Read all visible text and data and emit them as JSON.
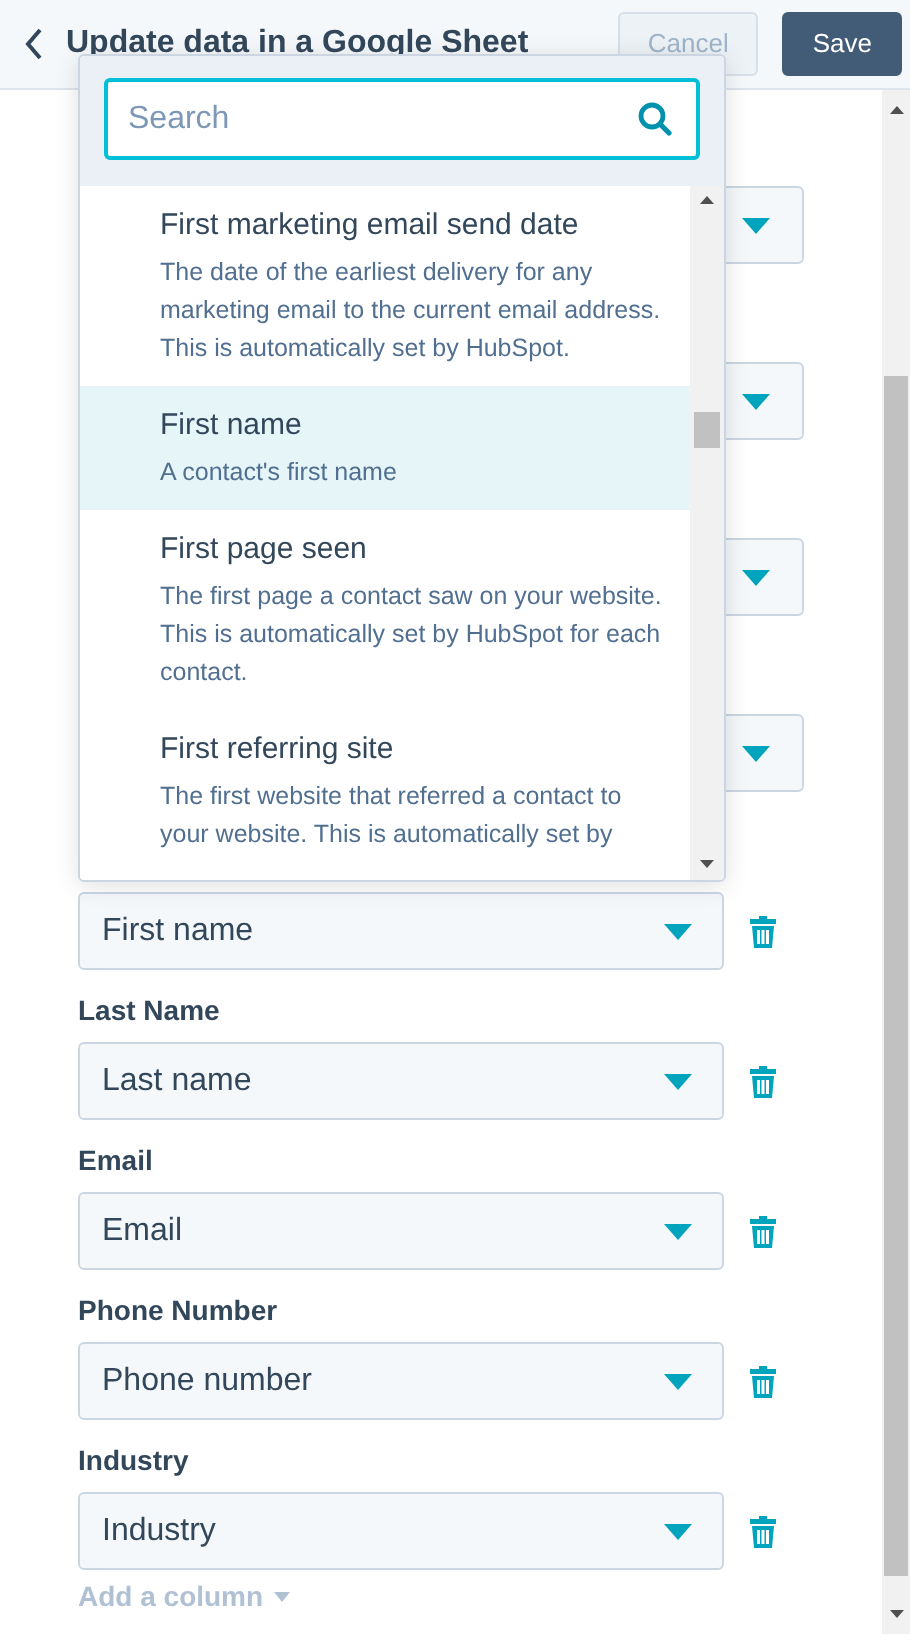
{
  "header": {
    "title": "Update data in a Google Sheet",
    "buttons": [
      {
        "label": "Cancel",
        "kind": "secondary",
        "disabled": true
      },
      {
        "label": "Save",
        "kind": "primary",
        "disabled": false
      }
    ]
  },
  "rows": [
    {
      "kind": "covered"
    },
    {
      "kind": "covered"
    },
    {
      "kind": "covered"
    },
    {
      "kind": "covered"
    },
    {
      "kind": "field",
      "value": "First name"
    },
    {
      "kind": "field",
      "label": "Last Name",
      "value": "Last name"
    },
    {
      "kind": "field",
      "label": "Email",
      "value": "Email"
    },
    {
      "kind": "field",
      "label": "Phone Number",
      "value": "Phone number"
    },
    {
      "kind": "field",
      "label": "Industry",
      "value": "Industry"
    }
  ],
  "add_column": {
    "label": "Add a column",
    "disabled": true
  },
  "dropdown": {
    "search": {
      "placeholder": "Search"
    },
    "options": [
      {
        "title": "First marketing email send date",
        "description": "The date of the earliest delivery for any marketing email to the current email address. This is automatically set by HubSpot.",
        "selected": false
      },
      {
        "title": "First name",
        "description": "A contact's first name",
        "selected": true
      },
      {
        "title": "First page seen",
        "description": "The first page a contact saw on your website. This is automatically set by HubSpot for each contact.",
        "selected": false
      },
      {
        "title": "First referring site",
        "description": "The first website that referred a contact to your website. This is automatically set by",
        "selected": false
      }
    ]
  }
}
